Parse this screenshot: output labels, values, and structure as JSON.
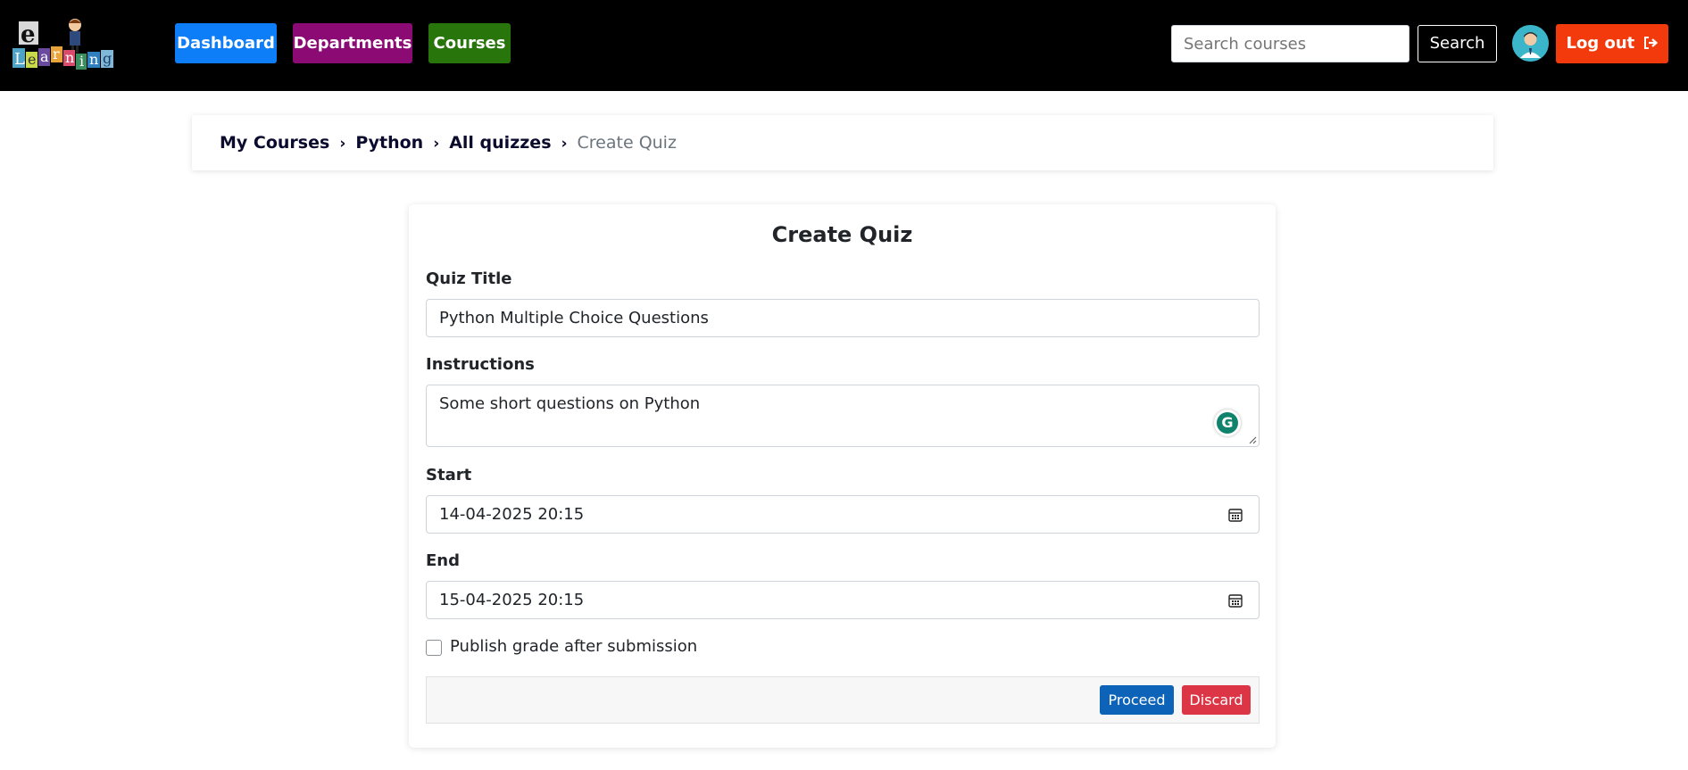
{
  "navbar": {
    "logo_text": "eLearning",
    "dashboard_label": "Dashboard",
    "departments_label": "Departments",
    "courses_label": "Courses",
    "search_placeholder": "Search courses",
    "search_button_label": "Search",
    "logout_label": "Log out",
    "colors": {
      "dashboard": "#0d7ef7",
      "departments": "#8b0a74",
      "courses": "#27750b",
      "logout": "#f23a0c"
    }
  },
  "breadcrumb": {
    "items": [
      "My Courses",
      "Python",
      "All quizzes"
    ],
    "current": "Create Quiz",
    "separator": "›"
  },
  "form": {
    "title": "Create Quiz",
    "quiz_title_label": "Quiz Title",
    "quiz_title_value": "Python Multiple Choice Questions",
    "instructions_label": "Instructions",
    "instructions_value": "Some short questions on Python",
    "start_label": "Start",
    "start_value": "14-04-2025 20:15",
    "end_label": "End",
    "end_value": "15-04-2025 20:15",
    "publish_label": "Publish grade after submission",
    "publish_checked": false,
    "proceed_label": "Proceed",
    "discard_label": "Discard"
  }
}
